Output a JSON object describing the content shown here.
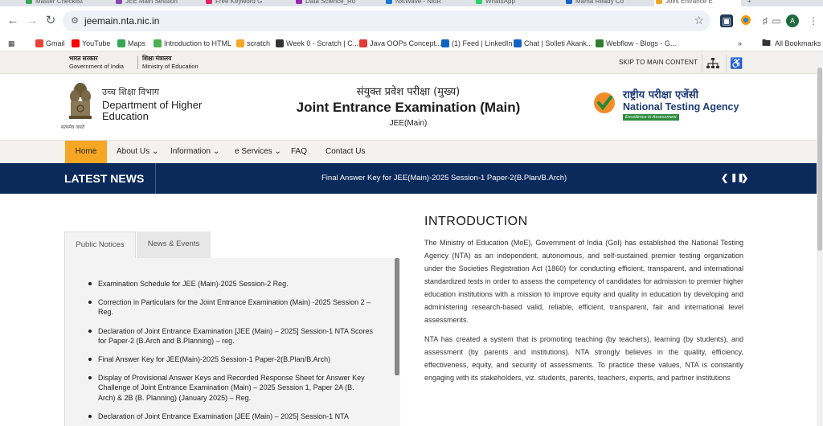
{
  "browser": {
    "tabs": [
      {
        "title": "Master Checklist",
        "color": "#34a853"
      },
      {
        "title": "JEE Main Session",
        "color": "#8e44ad"
      },
      {
        "title": "Free Keyword G",
        "color": "#e91e63"
      },
      {
        "title": "Data Science_Ro",
        "color": "#9c27b0"
      },
      {
        "title": "NxtWave - NxtR",
        "color": "#1976d2"
      },
      {
        "title": "WhatsApp",
        "color": "#25d366"
      },
      {
        "title": "Mama Ready Co",
        "color": "#1565c0"
      },
      {
        "title": "Joint Entrance E",
        "color": "#f5a623"
      }
    ],
    "url": "jeemain.nta.nic.in",
    "profile_initial": "A",
    "bookmarks": [
      {
        "label": "Gmail",
        "icon": "gmail-icon",
        "color": "#ea4335"
      },
      {
        "label": "YouTube",
        "icon": "youtube-icon",
        "color": "#ff0000"
      },
      {
        "label": "Maps",
        "icon": "maps-icon",
        "color": "#34a853"
      },
      {
        "label": "Introduction to HTML",
        "icon": "w3-icon",
        "color": "#4caf50"
      },
      {
        "label": "scratch",
        "icon": "scratch-icon",
        "color": "#f9a825"
      },
      {
        "label": "Week 0 - Scratch | C...",
        "icon": "cs50-icon",
        "color": "#333333"
      },
      {
        "label": "Java OOPs Concept...",
        "icon": "java-icon",
        "color": "#e53935"
      },
      {
        "label": "(1) Feed | LinkedIn",
        "icon": "linkedin-icon",
        "color": "#0a66c2"
      },
      {
        "label": "Chat | Solleti Akank...",
        "icon": "chat-icon",
        "color": "#1565c0"
      },
      {
        "label": "Webflow - Blogs - G...",
        "icon": "webflow-icon",
        "color": "#2e7d32"
      }
    ],
    "all_bookmarks_label": "All Bookmarks"
  },
  "gov": {
    "govt_hi": "भारत सरकार",
    "govt_en": "Government of India",
    "ministry_hi": "शिक्षा मंत्रालय",
    "ministry_en": "Ministry of Education",
    "skip_label": "SKIP TO MAIN CONTENT"
  },
  "header": {
    "dept_hi": "उच्च शिक्षा विभाग",
    "dept_en": "Department of Higher Education",
    "emblem_caption": "सत्यमेव जयते",
    "exam_hi": "संयुक्त प्रवेश परीक्षा (मुख्य)",
    "exam_en": "Joint Entrance Examination (Main)",
    "exam_short": "JEE(Main)",
    "nta_hi": "राष्ट्रीय परीक्षा एजेंसी",
    "nta_en": "National Testing Agency",
    "nta_tagline": "Excellence in Assessment"
  },
  "nav": {
    "items": [
      "Home",
      "About Us",
      "Information",
      "e Services",
      "FAQ",
      "Contact Us"
    ],
    "active": "Home"
  },
  "news": {
    "label": "LATEST NEWS",
    "ticker": "Final Answer Key for JEE(Main)-2025 Session-1 Paper-2(B.Plan/B.Arch)"
  },
  "notices": {
    "tabs": [
      "Public Notices",
      "News & Events"
    ],
    "items": [
      "Examination Schedule for JEE (Main)-2025 Session-2 Reg.",
      "Correction in Particulars for the Joint Entrance Examination (Main) -2025 Session 2 – Reg.",
      "Declaration of Joint Entrance Examination [JEE (Main) – 2025] Session-1 NTA Scores for Paper-2 (B.Arch and B.Planning) – reg.",
      "Final Answer Key for JEE(Main)-2025 Session-1 Paper-2(B.Plan/B.Arch)",
      "Display of Provisional Answer Keys and Recorded Response Sheet for Answer Key Challenge of Joint Entrance Examination (Main) – 2025 Session 1, Paper 2A (B. Arch) & 2B (B. Planning) (January 2025) – Reg.",
      "Declaration of Joint Entrance Examination [JEE (Main) – 2025] Session-1 NTA"
    ]
  },
  "intro": {
    "title": "INTRODUCTION",
    "p1": "The Ministry of Education (MoE), Government of India (GoI) has established the National Testing Agency (NTA) as an independent, autonomous, and self-sustained premier testing organization under the Societies Registration Act (1860) for conducting efficient, transparent, and international standardized tests in order to assess the competency of candidates for admission to premier higher education institutions with a mission to improve equity and quality in education by developing and administering research-based valid, reliable, efficient, transparent, fair and international level assessments.",
    "p2": "NTA has created a system that is promoting teaching (by teachers), learning (by students), and assessment (by parents and institutions). NTA strongly believes in the quality, efficiency, effectiveness, equity, and security of assessments. To practice these values, NTA is constantly engaging with its stakeholders, viz. students, parents, teachers, experts, and partner institutions"
  }
}
